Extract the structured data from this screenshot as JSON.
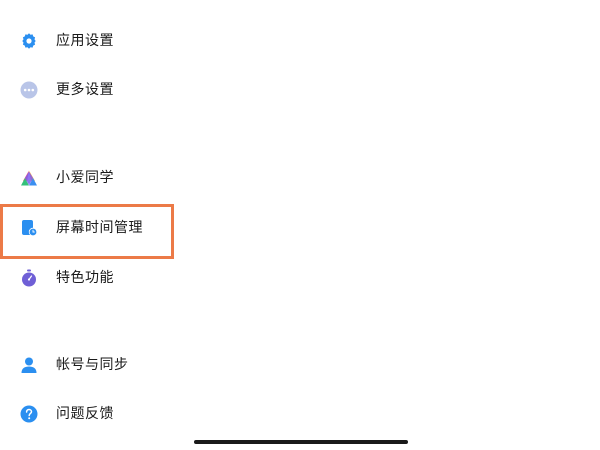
{
  "menu": {
    "app_settings": {
      "label": "应用设置",
      "icon": "gear-icon",
      "color": "#2b8ff0"
    },
    "more_settings": {
      "label": "更多设置",
      "icon": "more-dots-icon",
      "color": "#8fa3d9"
    },
    "xiaoai": {
      "label": "小爱同学",
      "icon": "xiaoai-icon",
      "color": "#3a8ef0"
    },
    "screen_time": {
      "label": "屏幕时间管理",
      "icon": "screen-time-icon",
      "color": "#2b8ff0"
    },
    "features": {
      "label": "特色功能",
      "icon": "stopwatch-icon",
      "color": "#6f5fd6"
    },
    "account_sync": {
      "label": "帐号与同步",
      "icon": "user-icon",
      "color": "#2b8ff0"
    },
    "feedback": {
      "label": "问题反馈",
      "icon": "question-icon",
      "color": "#2b8ff0"
    }
  },
  "colors": {
    "highlight_border": "#ec7a47",
    "text": "#1a1a1a",
    "background": "#ffffff"
  }
}
